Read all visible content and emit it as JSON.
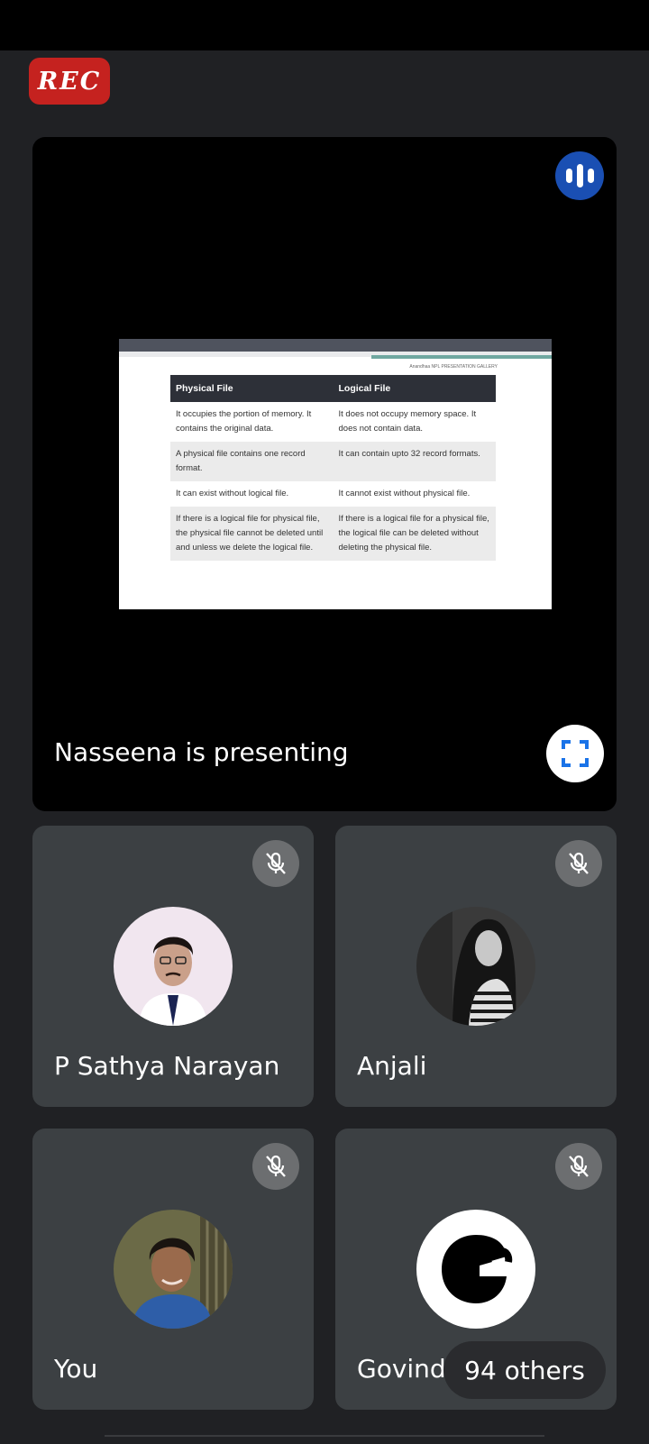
{
  "rec_label": "REC",
  "presentation": {
    "presenter_text": "Nasseena is presenting",
    "slide": {
      "note": "Anandhaa NPL PRESENTATION GALLERY",
      "headers": [
        "Physical File",
        "Logical File"
      ],
      "rows": [
        [
          "It occupies the portion of memory. It contains the original data.",
          "It does not occupy memory space. It does not contain data."
        ],
        [
          "A physical file contains one record format.",
          "It can contain upto 32 record formats."
        ],
        [
          "It can exist without logical file.",
          "It cannot exist without physical file."
        ],
        [
          "If there is a logical file for physical file, the physical file cannot be deleted until and unless we delete the logical file.",
          "If there is a logical file for a physical file, the logical file can be deleted without deleting the physical file."
        ]
      ]
    }
  },
  "participants": [
    {
      "name": "P Sathya Narayan",
      "mic": "mic-off-icon"
    },
    {
      "name": "Anjali",
      "mic": "mic-off-icon"
    },
    {
      "name": "You",
      "mic": "mic-off-icon"
    },
    {
      "name": "Govind",
      "mic": "mic-off-icon"
    }
  ],
  "others_label": "94 others",
  "colors": {
    "rec": "#c5221f",
    "speaking": "#1a4fb3",
    "tile": "#3c4043",
    "background": "#202124"
  }
}
